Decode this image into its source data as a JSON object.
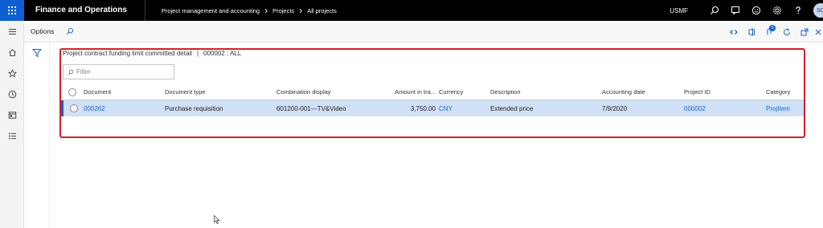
{
  "app": {
    "title": "Finance and Operations",
    "company": "USMF",
    "user_initials": "SC"
  },
  "breadcrumb": [
    "Project management and accounting",
    "Projects",
    "All projects"
  ],
  "actionbar": {
    "options_label": "Options",
    "notification_count": "0"
  },
  "form": {
    "title": "Project contract funding limit committed detail",
    "context": "000002 : ALL",
    "filter_placeholder": "Filter"
  },
  "grid": {
    "columns": [
      "Document",
      "Document type",
      "Combination display",
      "Amount in tra...",
      "Currency",
      "Description",
      "Accounting date",
      "Project ID",
      "Category"
    ],
    "rows": [
      {
        "document": "000262",
        "document_type": "Purchase requisition",
        "combination_display": "601200-001---TV&Video",
        "amount": "3,750.00",
        "currency": "CNY",
        "description": "Extended price",
        "accounting_date": "7/9/2020",
        "project_id": "000002",
        "category": "ProjItem"
      }
    ]
  },
  "colors": {
    "accent": "#0f5fd4",
    "highlight_border": "#d4202a",
    "selected_row": "#cfe0f7",
    "link": "#1e64c8"
  }
}
